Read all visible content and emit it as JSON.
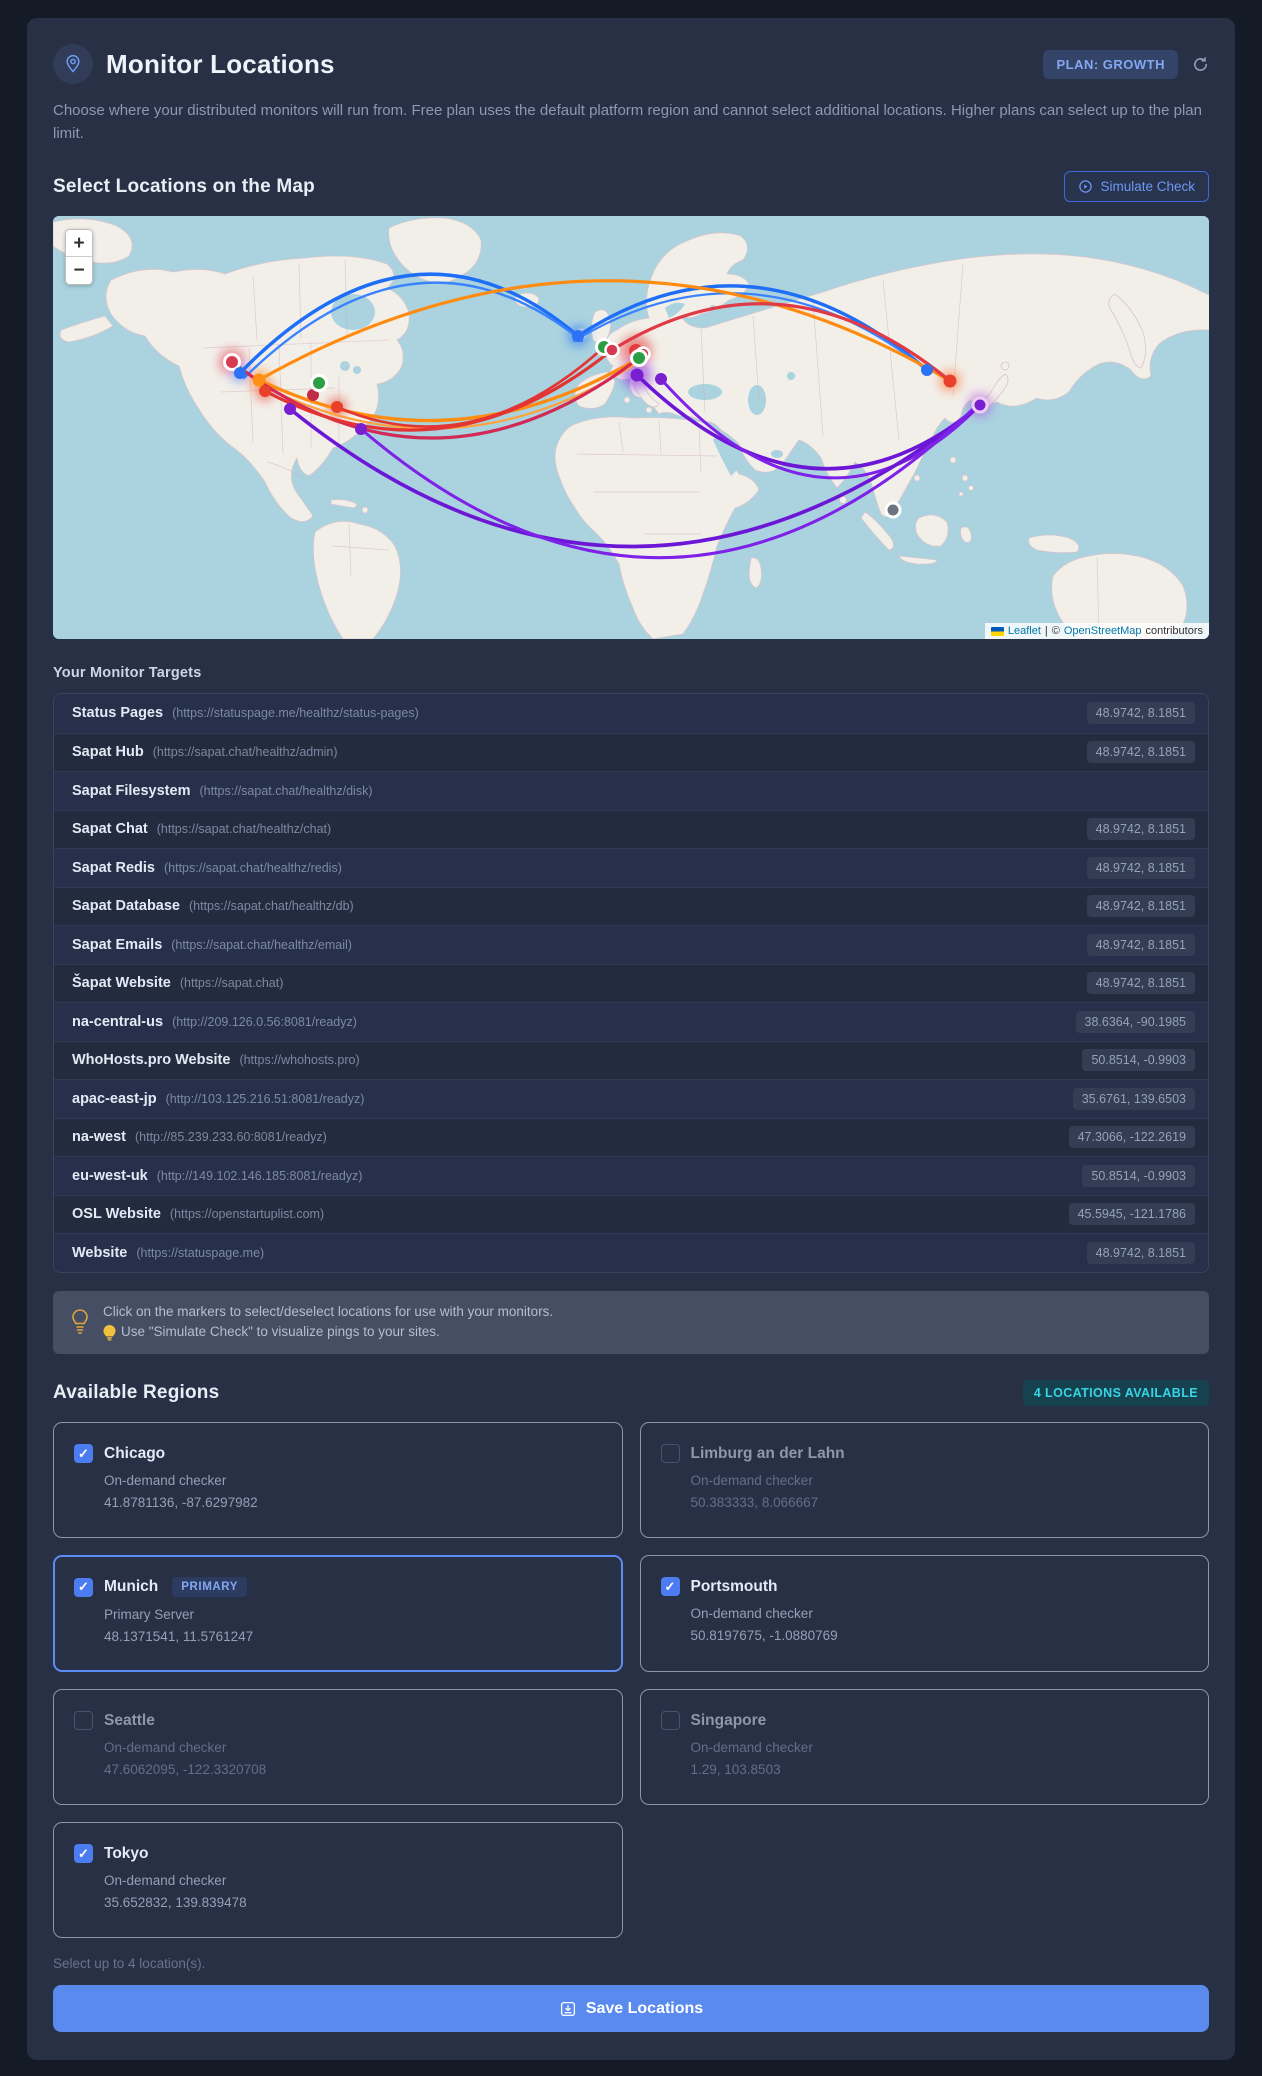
{
  "header": {
    "title": "Monitor Locations",
    "plan_badge": "PLAN: GROWTH",
    "description": "Choose where your distributed monitors will run from. Free plan uses the default platform region and cannot select additional locations. Higher plans can select up to the plan limit."
  },
  "map_section": {
    "heading": "Select Locations on the Map",
    "simulate_label": "Simulate Check",
    "zoom_in": "+",
    "zoom_out": "−",
    "attribution": {
      "leaflet": "Leaflet",
      "sep": "|",
      "copyright": "©",
      "osm": "OpenStreetMap",
      "suffix": "contributors"
    }
  },
  "targets": {
    "heading": "Your Monitor Targets",
    "rows": [
      {
        "name": "Status Pages",
        "url": "(https://statuspage.me/healthz/status-pages)",
        "coords": "48.9742, 8.1851"
      },
      {
        "name": "Sapat Hub",
        "url": "(https://sapat.chat/healthz/admin)",
        "coords": "48.9742, 8.1851"
      },
      {
        "name": "Sapat Filesystem",
        "url": "(https://sapat.chat/healthz/disk)"
      },
      {
        "name": "Sapat Chat",
        "url": "(https://sapat.chat/healthz/chat)",
        "coords": "48.9742, 8.1851"
      },
      {
        "name": "Sapat Redis",
        "url": "(https://sapat.chat/healthz/redis)",
        "coords": "48.9742, 8.1851"
      },
      {
        "name": "Sapat Database",
        "url": "(https://sapat.chat/healthz/db)",
        "coords": "48.9742, 8.1851"
      },
      {
        "name": "Sapat Emails",
        "url": "(https://sapat.chat/healthz/email)",
        "coords": "48.9742, 8.1851"
      },
      {
        "name": "Šapat Website",
        "url": "(https://sapat.chat)",
        "coords": "48.9742, 8.1851"
      },
      {
        "name": "na-central-us",
        "url": "(http://209.126.0.56:8081/readyz)",
        "coords": "38.6364, -90.1985"
      },
      {
        "name": "WhoHosts.pro Website",
        "url": "(https://whohosts.pro)",
        "coords": "50.8514, -0.9903"
      },
      {
        "name": "apac-east-jp",
        "url": "(http://103.125.216.51:8081/readyz)",
        "coords": "35.6761, 139.6503"
      },
      {
        "name": "na-west",
        "url": "(http://85.239.233.60:8081/readyz)",
        "coords": "47.3066, -122.2619"
      },
      {
        "name": "eu-west-uk",
        "url": "(http://149.102.146.185:8081/readyz)",
        "coords": "50.8514, -0.9903"
      },
      {
        "name": "OSL Website",
        "url": "(https://openstartuplist.com)",
        "coords": "45.5945, -121.1786"
      },
      {
        "name": "Website",
        "url": "(https://statuspage.me)",
        "coords": "48.9742, 8.1851"
      }
    ]
  },
  "tip": {
    "line1": "Click on the markers to select/deselect locations for use with your monitors.",
    "line2": "Use \"Simulate Check\" to visualize pings to your sites."
  },
  "regions": {
    "heading": "Available Regions",
    "badge": "4 LOCATIONS AVAILABLE",
    "footnote": "Select up to 4 location(s).",
    "cards": [
      {
        "name": "Chicago",
        "sub": "On-demand checker",
        "coords": "41.8781136, -87.6297982",
        "checked": true
      },
      {
        "name": "Limburg an der Lahn",
        "sub": "On-demand checker",
        "coords": "50.383333, 8.066667",
        "checked": false
      },
      {
        "name": "Munich",
        "badge": "PRIMARY",
        "sub": "Primary Server",
        "coords": "48.1371541, 11.5761247",
        "checked": true,
        "primary": true
      },
      {
        "name": "Portsmouth",
        "sub": "On-demand checker",
        "coords": "50.8197675, -1.0880769",
        "checked": true
      },
      {
        "name": "Seattle",
        "sub": "On-demand checker",
        "coords": "47.6062095, -122.3320708",
        "checked": false
      },
      {
        "name": "Singapore",
        "sub": "On-demand checker",
        "coords": "1.29, 103.8503",
        "checked": false
      },
      {
        "name": "Tokyo",
        "sub": "On-demand checker",
        "coords": "35.652832, 139.839478",
        "checked": true
      }
    ]
  },
  "save": {
    "label": "Save Locations"
  },
  "colors": {
    "accent_blue": "#5a8aee",
    "checkbox_blue": "#4b7cf0",
    "plan_badge_text": "#84a7f2",
    "teal_badge_text": "#38d4e6",
    "map_sea": "#aad3df",
    "map_land": "#f2efe9",
    "marker_red": "#e8402a",
    "marker_crimson": "#d63b52",
    "marker_blue": "#2b72f5",
    "marker_orange": "#ff8e17",
    "marker_green": "#2e9e44",
    "marker_purple": "#7a1fd0",
    "marker_gray": "#6b7280"
  }
}
